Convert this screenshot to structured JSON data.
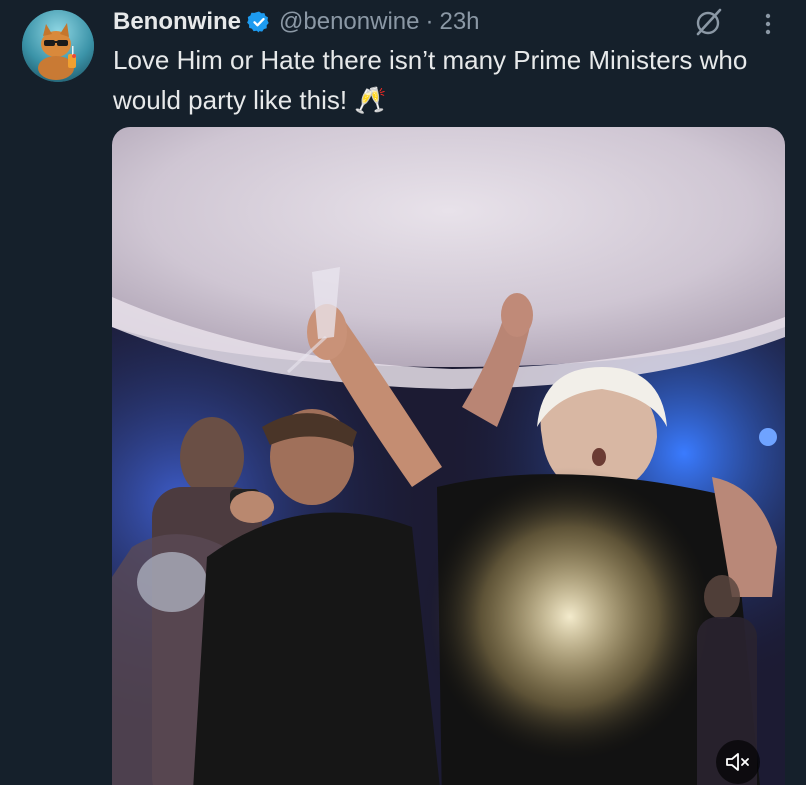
{
  "tweet": {
    "display_name": "Benonwine",
    "handle": "@benonwine",
    "separator": "·",
    "time": "23h",
    "text": "Love Him or Hate there isn’t many Prime Ministers who would party like this! 🥂"
  },
  "icons": {
    "verified": "verified-badge-icon",
    "grok": "grok-icon",
    "more": "more-options-icon",
    "mute": "muted-speaker-icon"
  },
  "colors": {
    "background": "#15202b",
    "text_primary": "#e7e9ea",
    "text_secondary": "#8b98a5",
    "verified_blue": "#1d9bf0"
  }
}
